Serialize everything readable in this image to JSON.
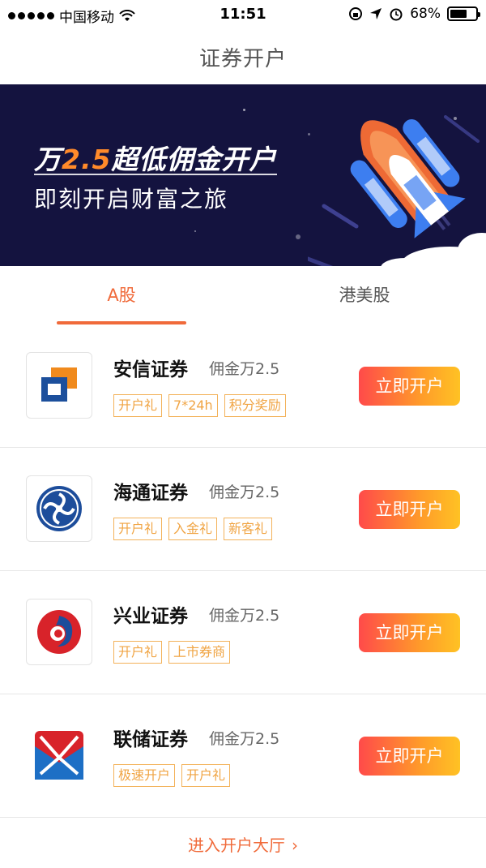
{
  "status": {
    "carrier": "中国移动",
    "time": "11:51",
    "battery": "68%",
    "battery_level": 0.68
  },
  "nav": {
    "title": "证券开户"
  },
  "banner": {
    "title_prefix": "万",
    "title_highlight": "2.5",
    "title_suffix": "超低佣金开户",
    "subtitle": "即刻开启财富之旅"
  },
  "tabs": [
    {
      "label": "A股",
      "active": true
    },
    {
      "label": "港美股",
      "active": false
    }
  ],
  "brokers": [
    {
      "name": "安信证券",
      "fee": "佣金万2.5",
      "tags": [
        "开户礼",
        "7*24h",
        "积分奖励"
      ],
      "button": "立即开户",
      "logo": "anxin-logo"
    },
    {
      "name": "海通证券",
      "fee": "佣金万2.5",
      "tags": [
        "开户礼",
        "入金礼",
        "新客礼"
      ],
      "button": "立即开户",
      "logo": "haitong-logo"
    },
    {
      "name": "兴业证券",
      "fee": "佣金万2.5",
      "tags": [
        "开户礼",
        "上市券商"
      ],
      "button": "立即开户",
      "logo": "xingye-logo"
    },
    {
      "name": "联储证券",
      "fee": "佣金万2.5",
      "tags": [
        "极速开户",
        "开户礼"
      ],
      "button": "立即开户",
      "logo": "lianchu-logo"
    }
  ],
  "footer": {
    "link": "进入开户大厅"
  },
  "colors": {
    "accent": "#f06a3a",
    "banner_bg": "#14133f",
    "tag": "#f0a443"
  }
}
